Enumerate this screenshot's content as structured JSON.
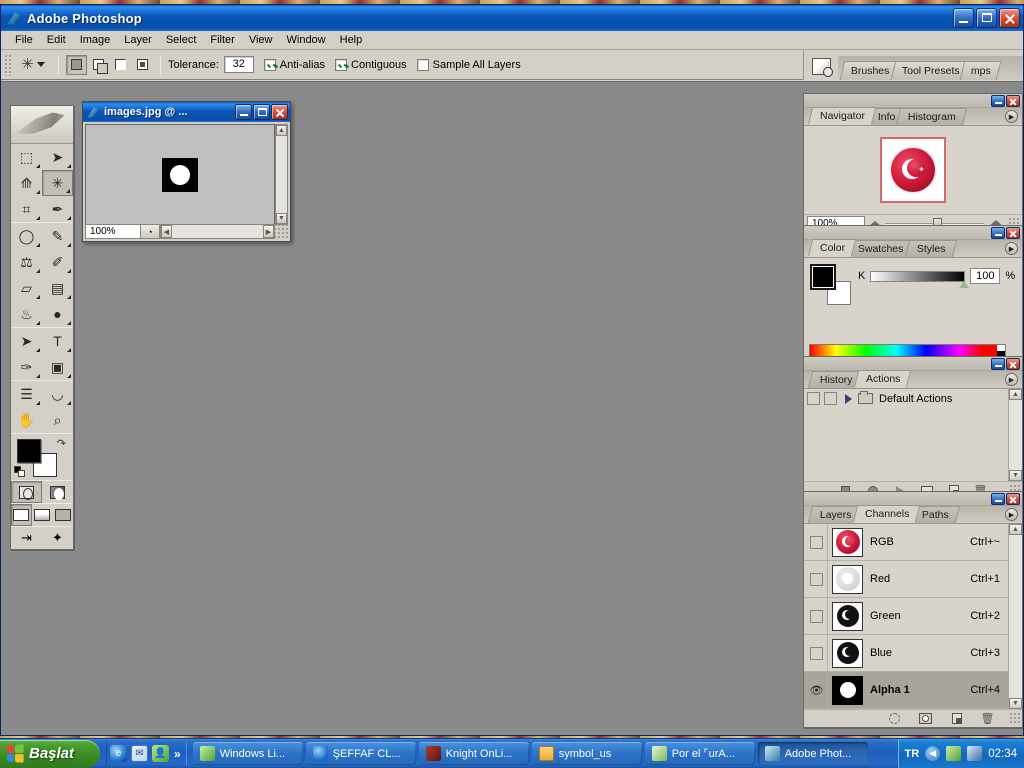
{
  "app": {
    "title": "Adobe Photoshop",
    "icon": "photoshop-feather-icon"
  },
  "window_controls": {
    "minimize": "minimize-icon",
    "maximize": "maximize-icon",
    "close": "close-icon"
  },
  "menu": {
    "items": [
      "File",
      "Edit",
      "Image",
      "Layer",
      "Select",
      "Filter",
      "View",
      "Window",
      "Help"
    ]
  },
  "options_bar": {
    "tool_icon": "magic-wand-icon",
    "selection_modes": [
      "new-selection",
      "add-to-selection",
      "subtract-from-selection",
      "intersect-with-selection"
    ],
    "tolerance_label": "Tolerance:",
    "tolerance_value": "32",
    "anti_alias_label": "Anti-alias",
    "anti_alias_checked": true,
    "contiguous_label": "Contiguous",
    "contiguous_checked": true,
    "sample_all_layers_label": "Sample All Layers",
    "sample_all_layers_checked": false
  },
  "palette_well": {
    "icon": "file-browser-icon",
    "tabs": [
      "Brushes",
      "Tool Presets",
      "mps"
    ]
  },
  "toolbox": {
    "logo": "photoshop-feather-logo",
    "tools": [
      {
        "name": "marquee-tool",
        "glyph": "⬚"
      },
      {
        "name": "move-tool",
        "glyph": "➤"
      },
      {
        "name": "lasso-tool",
        "glyph": "➰"
      },
      {
        "name": "magic-wand-tool",
        "glyph": "✳",
        "selected": true
      },
      {
        "name": "crop-tool",
        "glyph": "⌗"
      },
      {
        "name": "slice-tool",
        "glyph": "✂"
      },
      {
        "name": "healing-brush-tool",
        "glyph": "✒"
      },
      {
        "name": "brush-tool",
        "glyph": "✎"
      },
      {
        "name": "clone-stamp-tool",
        "glyph": "⚒"
      },
      {
        "name": "history-brush-tool",
        "glyph": "✐"
      },
      {
        "name": "eraser-tool",
        "glyph": "▱"
      },
      {
        "name": "gradient-tool",
        "glyph": "▤"
      },
      {
        "name": "blur-tool",
        "glyph": "●"
      },
      {
        "name": "dodge-tool",
        "glyph": "◖"
      },
      {
        "name": "path-selection-tool",
        "glyph": "➤"
      },
      {
        "name": "type-tool",
        "glyph": "T"
      },
      {
        "name": "pen-tool",
        "glyph": "✑"
      },
      {
        "name": "shape-tool",
        "glyph": "■"
      },
      {
        "name": "notes-tool",
        "glyph": "≡"
      },
      {
        "name": "eyedropper-tool",
        "glyph": "⚗"
      },
      {
        "name": "hand-tool",
        "glyph": "✋"
      },
      {
        "name": "zoom-tool",
        "glyph": "⌕"
      }
    ],
    "foreground_color": "#000000",
    "background_color": "#ffffff",
    "mask_modes": [
      "standard-mask-mode",
      "quick-mask-mode"
    ],
    "screen_modes": [
      "standard-screen-mode",
      "full-screen-with-menubar",
      "full-screen-mode"
    ],
    "jump_to": "jump-to-imageready-icon"
  },
  "document": {
    "title": "images.jpg @ ...",
    "icon": "document-icon",
    "zoom": "100%",
    "canvas_description": "alpha-channel-white-circle-on-black"
  },
  "navigator": {
    "tabs": [
      "Navigator",
      "Info",
      "Histogram"
    ],
    "active_tab": "Navigator",
    "zoom_value": "100%",
    "thumbnail": "turkish-flag-button-thumbnail"
  },
  "color": {
    "tabs": [
      "Color",
      "Swatches",
      "Styles"
    ],
    "active_tab": "Color",
    "channel_label": "K",
    "channel_value": "100",
    "unit": "%",
    "foreground": "#000000",
    "background": "#ffffff"
  },
  "actions": {
    "tabs": [
      "History",
      "Actions"
    ],
    "active_tab": "Actions",
    "rows": [
      {
        "label": "Default Actions",
        "type": "action-set"
      }
    ],
    "footer_buttons": [
      "stop-button",
      "record-button",
      "play-button",
      "new-set-button",
      "new-action-button",
      "delete-button"
    ]
  },
  "channels": {
    "tabs": [
      "Layers",
      "Channels",
      "Paths"
    ],
    "active_tab": "Channels",
    "rows": [
      {
        "name": "RGB",
        "shortcut": "Ctrl+~",
        "visible": false,
        "selected": false,
        "thumb": "composite-rgb-thumb"
      },
      {
        "name": "Red",
        "shortcut": "Ctrl+1",
        "visible": false,
        "selected": false,
        "thumb": "red-channel-thumb"
      },
      {
        "name": "Green",
        "shortcut": "Ctrl+2",
        "visible": false,
        "selected": false,
        "thumb": "green-channel-thumb"
      },
      {
        "name": "Blue",
        "shortcut": "Ctrl+3",
        "visible": false,
        "selected": false,
        "thumb": "blue-channel-thumb"
      },
      {
        "name": "Alpha 1",
        "shortcut": "Ctrl+4",
        "visible": true,
        "selected": true,
        "thumb": "alpha-channel-thumb"
      }
    ],
    "footer_buttons": [
      "load-channel-as-selection",
      "save-selection-as-channel",
      "new-channel",
      "delete-channel"
    ]
  },
  "taskbar": {
    "start_label": "Başlat",
    "quick_launch": [
      "internet-explorer-icon",
      "outlook-express-icon",
      "msn-messenger-icon"
    ],
    "overflow": "»",
    "tasks": [
      {
        "label": "Windows Li...",
        "icon": "msn-messenger-icon",
        "active": false
      },
      {
        "label": "ŞEFFAF CL...",
        "icon": "internet-explorer-icon",
        "active": false
      },
      {
        "label": "Knight OnLi...",
        "icon": "game-icon",
        "active": false
      },
      {
        "label": "symbol_us",
        "icon": "folder-icon",
        "active": false
      },
      {
        "label": "Por el ⌜urA...",
        "icon": "person-icon",
        "active": false
      },
      {
        "label": "Adobe Phot...",
        "icon": "photoshop-icon",
        "active": true
      }
    ],
    "tray": {
      "language": "TR",
      "chevron": "◀",
      "icons": [
        "msn-messenger-tray-icon",
        "network-tray-icon"
      ],
      "clock": "02:34"
    }
  }
}
